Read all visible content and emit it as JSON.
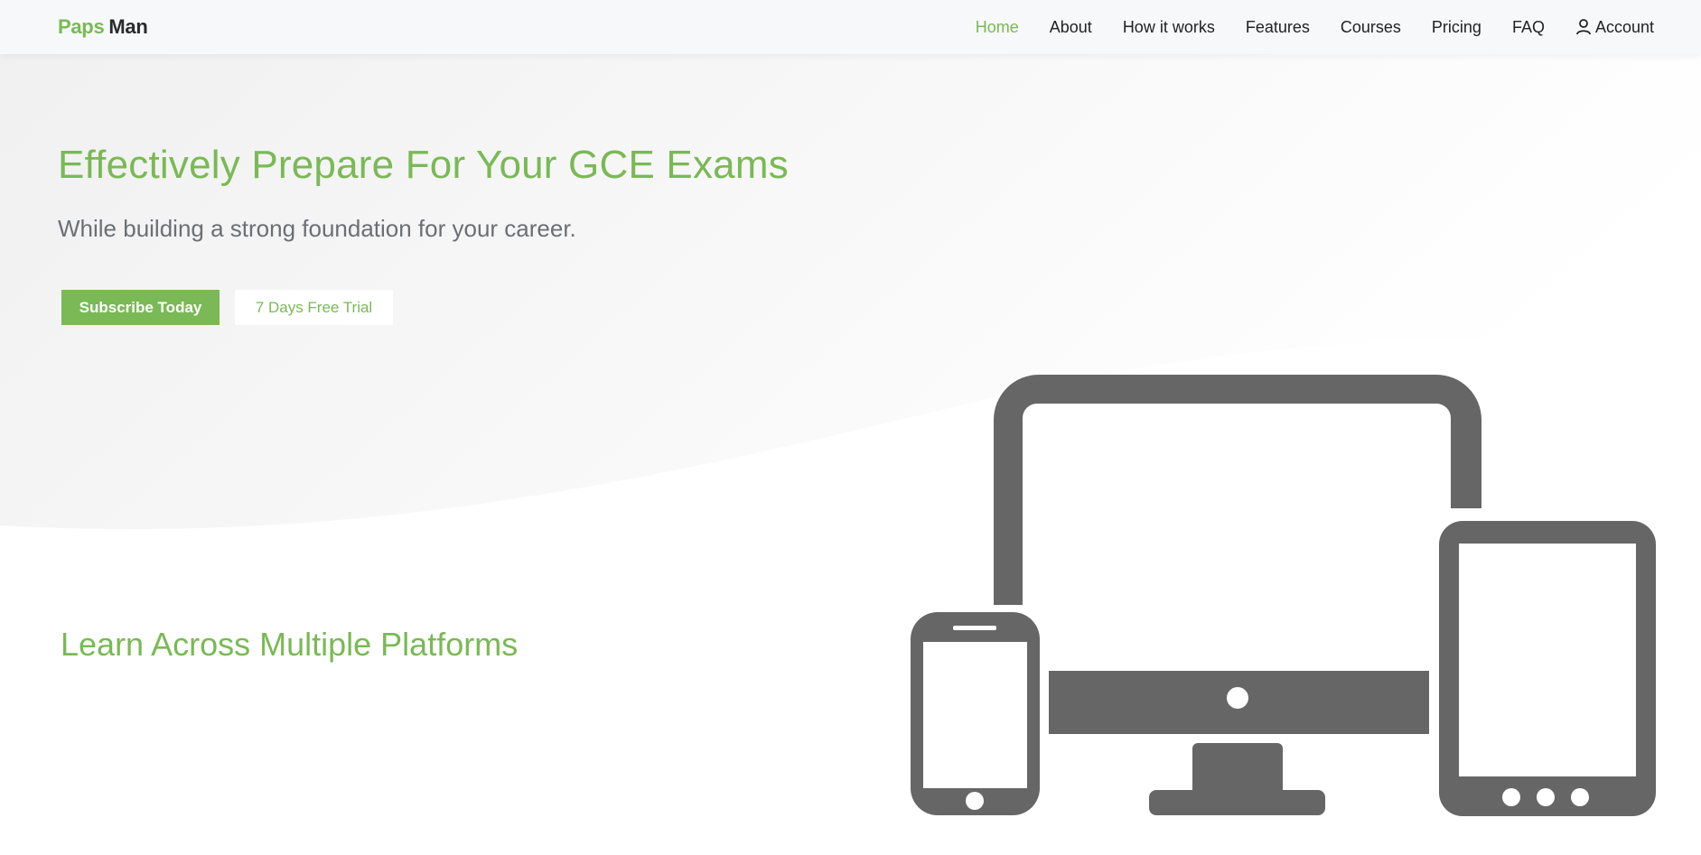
{
  "brand": {
    "part1": "Paps",
    "part2": "Man"
  },
  "nav": {
    "items": [
      {
        "label": "Home",
        "active": true
      },
      {
        "label": "About"
      },
      {
        "label": "How it works"
      },
      {
        "label": "Features"
      },
      {
        "label": "Courses"
      },
      {
        "label": "Pricing"
      },
      {
        "label": "FAQ"
      }
    ],
    "account_label": "Account",
    "account_icon": "user-icon"
  },
  "hero": {
    "title": "Effectively Prepare For Your GCE Exams",
    "subtitle": "While building a strong foundation for your career.",
    "primary_button": "Subscribe Today",
    "secondary_button": "7 Days Free Trial"
  },
  "platforms": {
    "title": "Learn Across Multiple Platforms",
    "illustration_icon": "devices-icon"
  },
  "colors": {
    "accent": "#7ab955",
    "dark_text": "#222222",
    "muted_text": "#6b6f75",
    "device_gray": "#666666"
  }
}
